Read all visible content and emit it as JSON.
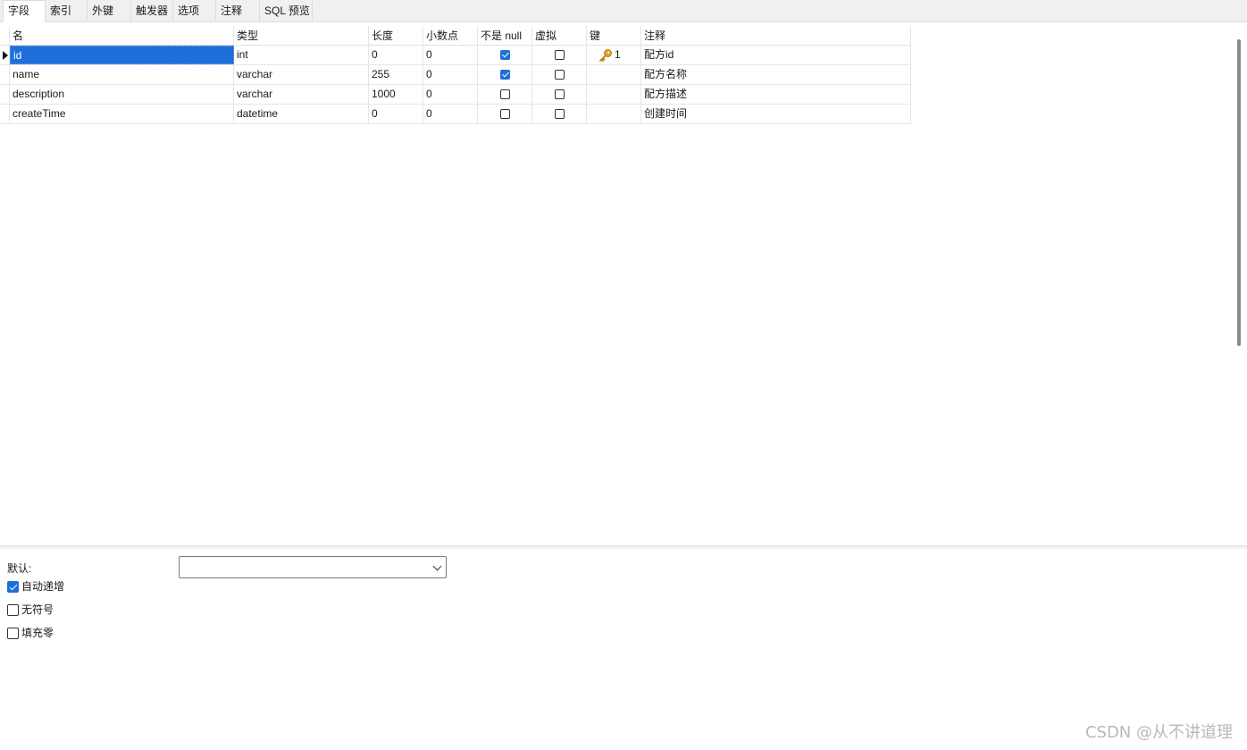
{
  "tabs": [
    {
      "label": "字段",
      "active": true
    },
    {
      "label": "索引",
      "active": false
    },
    {
      "label": "外键",
      "active": false
    },
    {
      "label": "触发器",
      "active": false
    },
    {
      "label": "选项",
      "active": false
    },
    {
      "label": "注释",
      "active": false
    },
    {
      "label": "SQL 预览",
      "active": false
    }
  ],
  "grid": {
    "columns": [
      "名",
      "类型",
      "长度",
      "小数点",
      "不是 null",
      "虚拟",
      "键",
      "注释"
    ],
    "rows": [
      {
        "name": "id",
        "type": "int",
        "length": "0",
        "decimals": "0",
        "not_null": true,
        "virtual": false,
        "key": "1",
        "comment": "配方id",
        "current": true,
        "name_selected": true
      },
      {
        "name": "name",
        "type": "varchar",
        "length": "255",
        "decimals": "0",
        "not_null": true,
        "virtual": false,
        "key": "",
        "comment": "配方名称",
        "current": false
      },
      {
        "name": "description",
        "type": "varchar",
        "length": "1000",
        "decimals": "0",
        "not_null": false,
        "virtual": false,
        "key": "",
        "comment": "配方描述",
        "current": false
      },
      {
        "name": "createTime",
        "type": "datetime",
        "length": "0",
        "decimals": "0",
        "not_null": false,
        "virtual": false,
        "key": "",
        "comment": "创建时间",
        "current": false
      }
    ]
  },
  "properties": {
    "default_label": "默认:",
    "default_value": "",
    "auto_increment": {
      "label": "自动递增",
      "checked": true
    },
    "unsigned": {
      "label": "无符号",
      "checked": false
    },
    "zerofill": {
      "label": "填充零",
      "checked": false
    }
  },
  "watermark": "CSDN @从不讲道理",
  "colors": {
    "accent": "#1e6fd9",
    "key_icon": "#e0a52a"
  }
}
